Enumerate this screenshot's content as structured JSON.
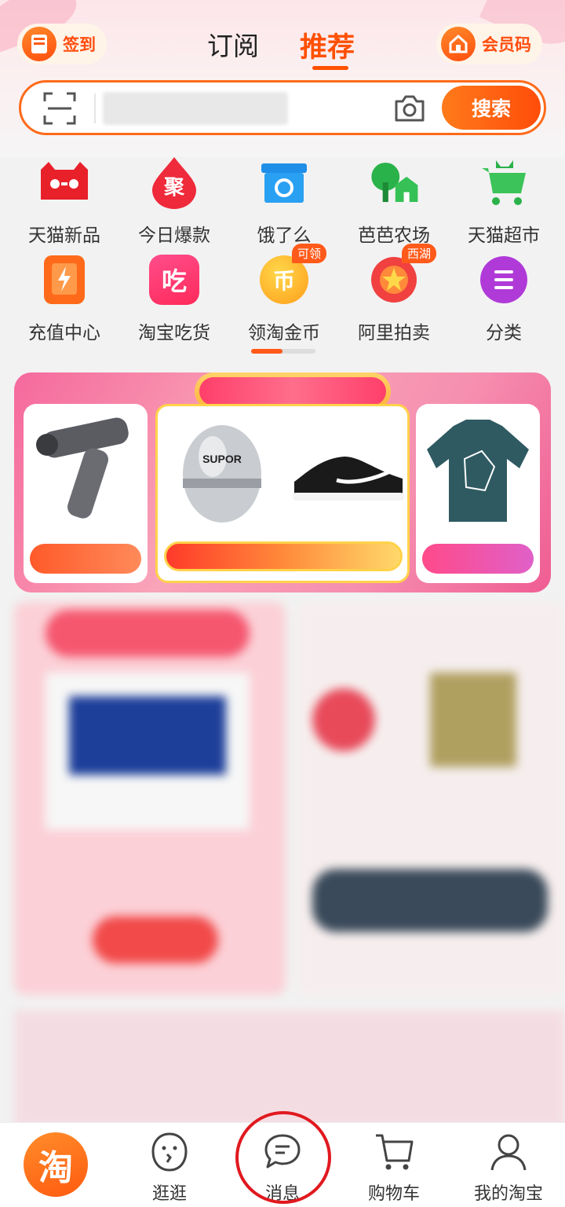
{
  "header": {
    "signin_label": "签到",
    "tabs": [
      {
        "label": "订阅",
        "active": false
      },
      {
        "label": "推荐",
        "active": true
      }
    ],
    "member_code_label": "会员码",
    "accent_color": "#ff5000"
  },
  "search": {
    "placeholder": "",
    "button_label": "搜索"
  },
  "grid": {
    "items": [
      {
        "label": "天猫新品",
        "icon": "tmall-cat-icon"
      },
      {
        "label": "今日爆款",
        "icon": "ju-drop-icon"
      },
      {
        "label": "饿了么",
        "icon": "eleme-box-icon"
      },
      {
        "label": "芭芭农场",
        "icon": "farm-tree-icon"
      },
      {
        "label": "天猫超市",
        "icon": "tmall-cart-icon"
      },
      {
        "label": "充值中心",
        "icon": "recharge-icon"
      },
      {
        "label": "淘宝吃货",
        "icon": "chi-food-icon"
      },
      {
        "label": "领淘金币",
        "icon": "coin-icon",
        "badge": "可领"
      },
      {
        "label": "阿里拍卖",
        "icon": "auction-icon",
        "badge": "西湖"
      },
      {
        "label": "分类",
        "icon": "menu-icon"
      }
    ],
    "coin_glyph": "币",
    "chi_glyph": "吃",
    "ju_glyph": "聚"
  },
  "promo": {
    "products": [
      "massage-gun",
      "egg-timer",
      "sneaker",
      "sweatshirt"
    ],
    "timer_brand": "SUPOR"
  },
  "bottom_nav": {
    "items": [
      {
        "label": "淘",
        "icon": "taobao-home-icon"
      },
      {
        "label": "逛逛",
        "icon": "guangguang-icon"
      },
      {
        "label": "消息",
        "icon": "message-icon"
      },
      {
        "label": "购物车",
        "icon": "cart-icon"
      },
      {
        "label": "我的淘宝",
        "icon": "profile-icon"
      }
    ]
  }
}
